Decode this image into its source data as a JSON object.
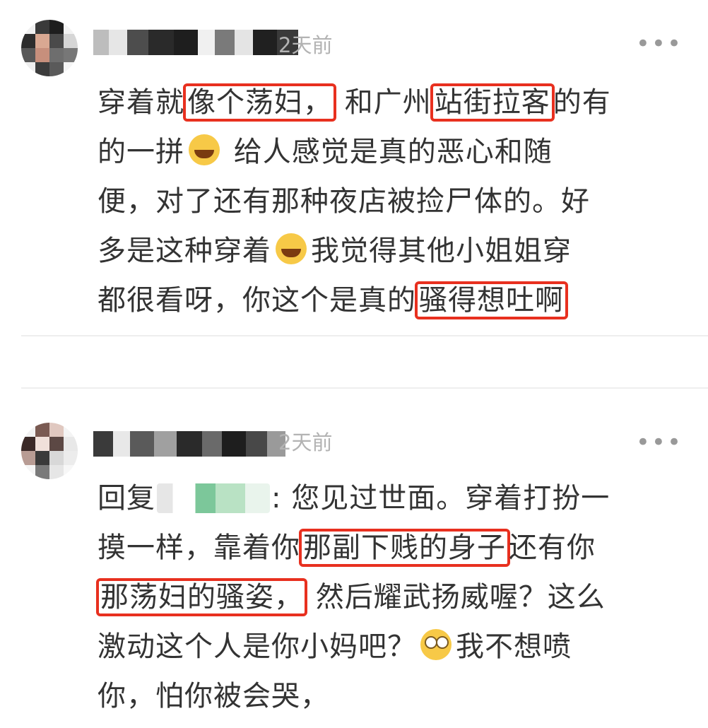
{
  "comments": [
    {
      "time": "2天前",
      "more": "•••",
      "lines": [
        [
          {
            "t": "穿着就"
          },
          {
            "t": "像个荡妇，",
            "hl": true
          },
          {
            "t": " 和广州"
          },
          {
            "t": "站街拉客",
            "hl": true
          },
          {
            "t": "的有"
          }
        ],
        [
          {
            "t": "的一拼"
          },
          {
            "emoji": "laugh"
          },
          {
            "t": " 给人感觉是真的恶心和随"
          }
        ],
        [
          {
            "t": "便，对了还有那种夜店被捡尸体的。好"
          }
        ],
        [
          {
            "t": "多是这种穿着"
          },
          {
            "emoji": "laugh"
          },
          {
            "t": "我觉得其他小姐姐穿"
          }
        ],
        [
          {
            "t": "都很看呀，你这个是真的"
          },
          {
            "t": "骚得想吐啊",
            "hl": true
          }
        ]
      ]
    },
    {
      "time": "2天前",
      "more": "•••",
      "lines": [
        [
          {
            "t": "回复"
          },
          {
            "mention": true
          },
          {
            "t": ": 您见过世面。穿着打扮一"
          }
        ],
        [
          {
            "t": "摸一样，靠着你"
          },
          {
            "t": "那副下贱的身子",
            "hl": true
          },
          {
            "t": "还有你"
          }
        ],
        [
          {
            "t": "那荡妇的骚姿，",
            "hl": true
          },
          {
            "t": " 然后耀武扬威喔？这么"
          }
        ],
        [
          {
            "t": "激动这个人是你小妈吧？"
          },
          {
            "emoji": "roll"
          },
          {
            "t": "我不想喷"
          }
        ],
        [
          {
            "t": "你，怕你被会哭，"
          }
        ]
      ]
    }
  ],
  "colors": {
    "highlight_border": "#e8301f",
    "text": "#333333",
    "timestamp": "#b3b3b3"
  }
}
